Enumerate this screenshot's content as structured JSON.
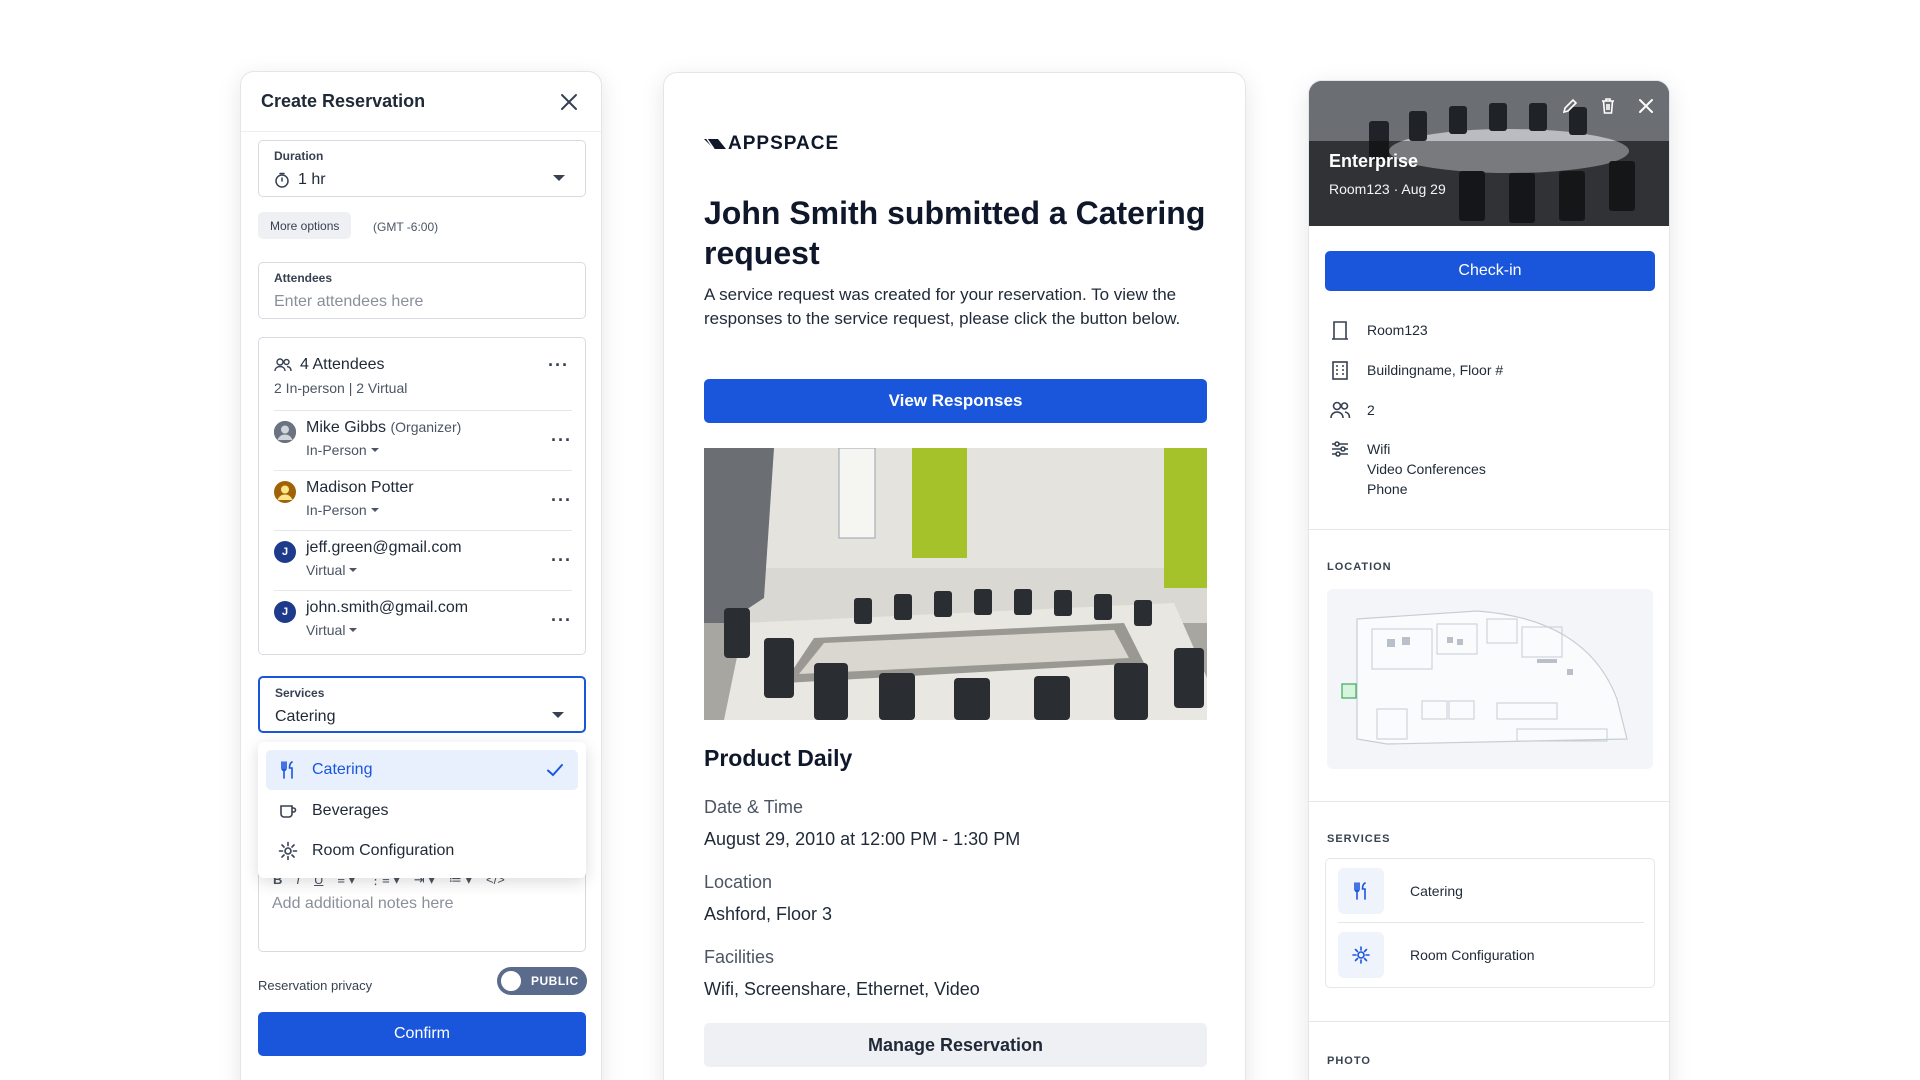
{
  "create_reservation": {
    "title": "Create Reservation",
    "duration": {
      "label": "Duration",
      "value": "1 hr"
    },
    "more_options": "More options",
    "timezone": "(GMT -6:00)",
    "attendees_input": {
      "label": "Attendees",
      "placeholder": "Enter attendees here"
    },
    "attendees_summary": {
      "count": "4 Attendees",
      "breakdown": "2 In-person | 2 Virtual"
    },
    "attendees": [
      {
        "name": "Mike Gibbs",
        "role": "(Organizer)",
        "mode": "In-Person",
        "avatar": ""
      },
      {
        "name": "Madison Potter",
        "role": "",
        "mode": "In-Person",
        "avatar": ""
      },
      {
        "name": "jeff.green@gmail.com",
        "role": "",
        "mode": "Virtual",
        "avatar": "J"
      },
      {
        "name": "john.smith@gmail.com",
        "role": "",
        "mode": "Virtual",
        "avatar": "J"
      }
    ],
    "services": {
      "label": "Services",
      "value": "Catering"
    },
    "service_options": [
      "Catering",
      "Beverages",
      "Room Configuration"
    ],
    "notes_placeholder": "Add additional notes here",
    "toolbar": [
      "B",
      "I",
      "U",
      "≡ ▾",
      "⋮≡ ▾",
      "⇥ ▾",
      "≔ ▾",
      "</>"
    ],
    "privacy_label": "Reservation privacy",
    "privacy_value": "PUBLIC",
    "confirm": "Confirm"
  },
  "email": {
    "logo": "APPSPACE",
    "title": "John Smith submitted a Catering request",
    "description": "A service request was created for your reservation. To view the responses to the service request, please click the button below.",
    "view_button": "View Responses",
    "event_title": "Product Daily",
    "date_label": "Date & Time",
    "date_value": "August 29, 2010 at 12:00 PM - 1:30 PM",
    "location_label": "Location",
    "location_value": "Ashford, Floor 3",
    "facilities_label": "Facilities",
    "facilities_value": "Wifi, Screenshare, Ethernet, Video",
    "manage_button": "Manage Reservation"
  },
  "room_details": {
    "title": "Enterprise",
    "subtitle": "Room123 · Aug 29",
    "checkin": "Check-in",
    "room": "Room123",
    "building": "Buildingname, Floor #",
    "capacity": "2",
    "amenities": [
      "Wifi",
      "Video Conferences",
      "Phone"
    ],
    "location_label": "LOCATION",
    "services_label": "SERVICES",
    "services": [
      "Catering",
      "Room Configuration"
    ],
    "photo_label": "PHOTO"
  },
  "colors": {
    "primary": "#1a56db",
    "toggle": "#5a6b8c",
    "avatar_dark": "#1e3a8a"
  }
}
